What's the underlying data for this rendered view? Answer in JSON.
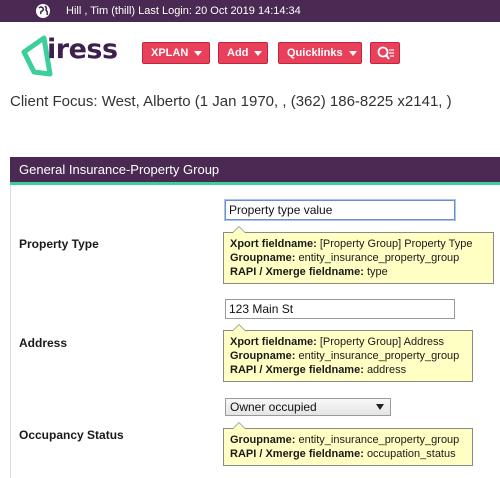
{
  "header": {
    "login_text": "Hill , Tim (thill) Last Login: 20 Oct 2019 14:14:34"
  },
  "logo": {
    "text": "iress",
    "brand_color": "#3ccf9a"
  },
  "nav": {
    "xplan_label": "XPLAN",
    "add_label": "Add",
    "quicklinks_label": "Quicklinks",
    "button_color": "#e9405b"
  },
  "client_focus": "Client Focus: West, Alberto (1 Jan 1970, , (362) 186-8225 x2141, )",
  "section": {
    "title": "General Insurance-Property Group",
    "accent_color": "#3ccf9a",
    "bar_color": "#4a2a52"
  },
  "fields": {
    "property_type": {
      "label": "Property Type",
      "value": "Property type value",
      "tooltip": {
        "xport_label": "Xport fieldname:",
        "xport_value": "[Property Group] Property Type",
        "group_label": "Groupname:",
        "group_value": "entity_insurance_property_group",
        "rapi_label": "RAPI / Xmerge fieldname:",
        "rapi_value": "type"
      }
    },
    "address": {
      "label": "Address",
      "value": "123 Main St",
      "tooltip": {
        "xport_label": "Xport fieldname:",
        "xport_value": "[Property Group] Address",
        "group_label": "Groupname:",
        "group_value": "entity_insurance_property_group",
        "rapi_label": "RAPI / Xmerge fieldname:",
        "rapi_value": "address"
      }
    },
    "occupancy_status": {
      "label": "Occupancy Status",
      "selected": "Owner occupied",
      "tooltip": {
        "group_label": "Groupname:",
        "group_value": "entity_insurance_property_group",
        "rapi_label": "RAPI / Xmerge fieldname:",
        "rapi_value": "occupation_status"
      }
    }
  }
}
